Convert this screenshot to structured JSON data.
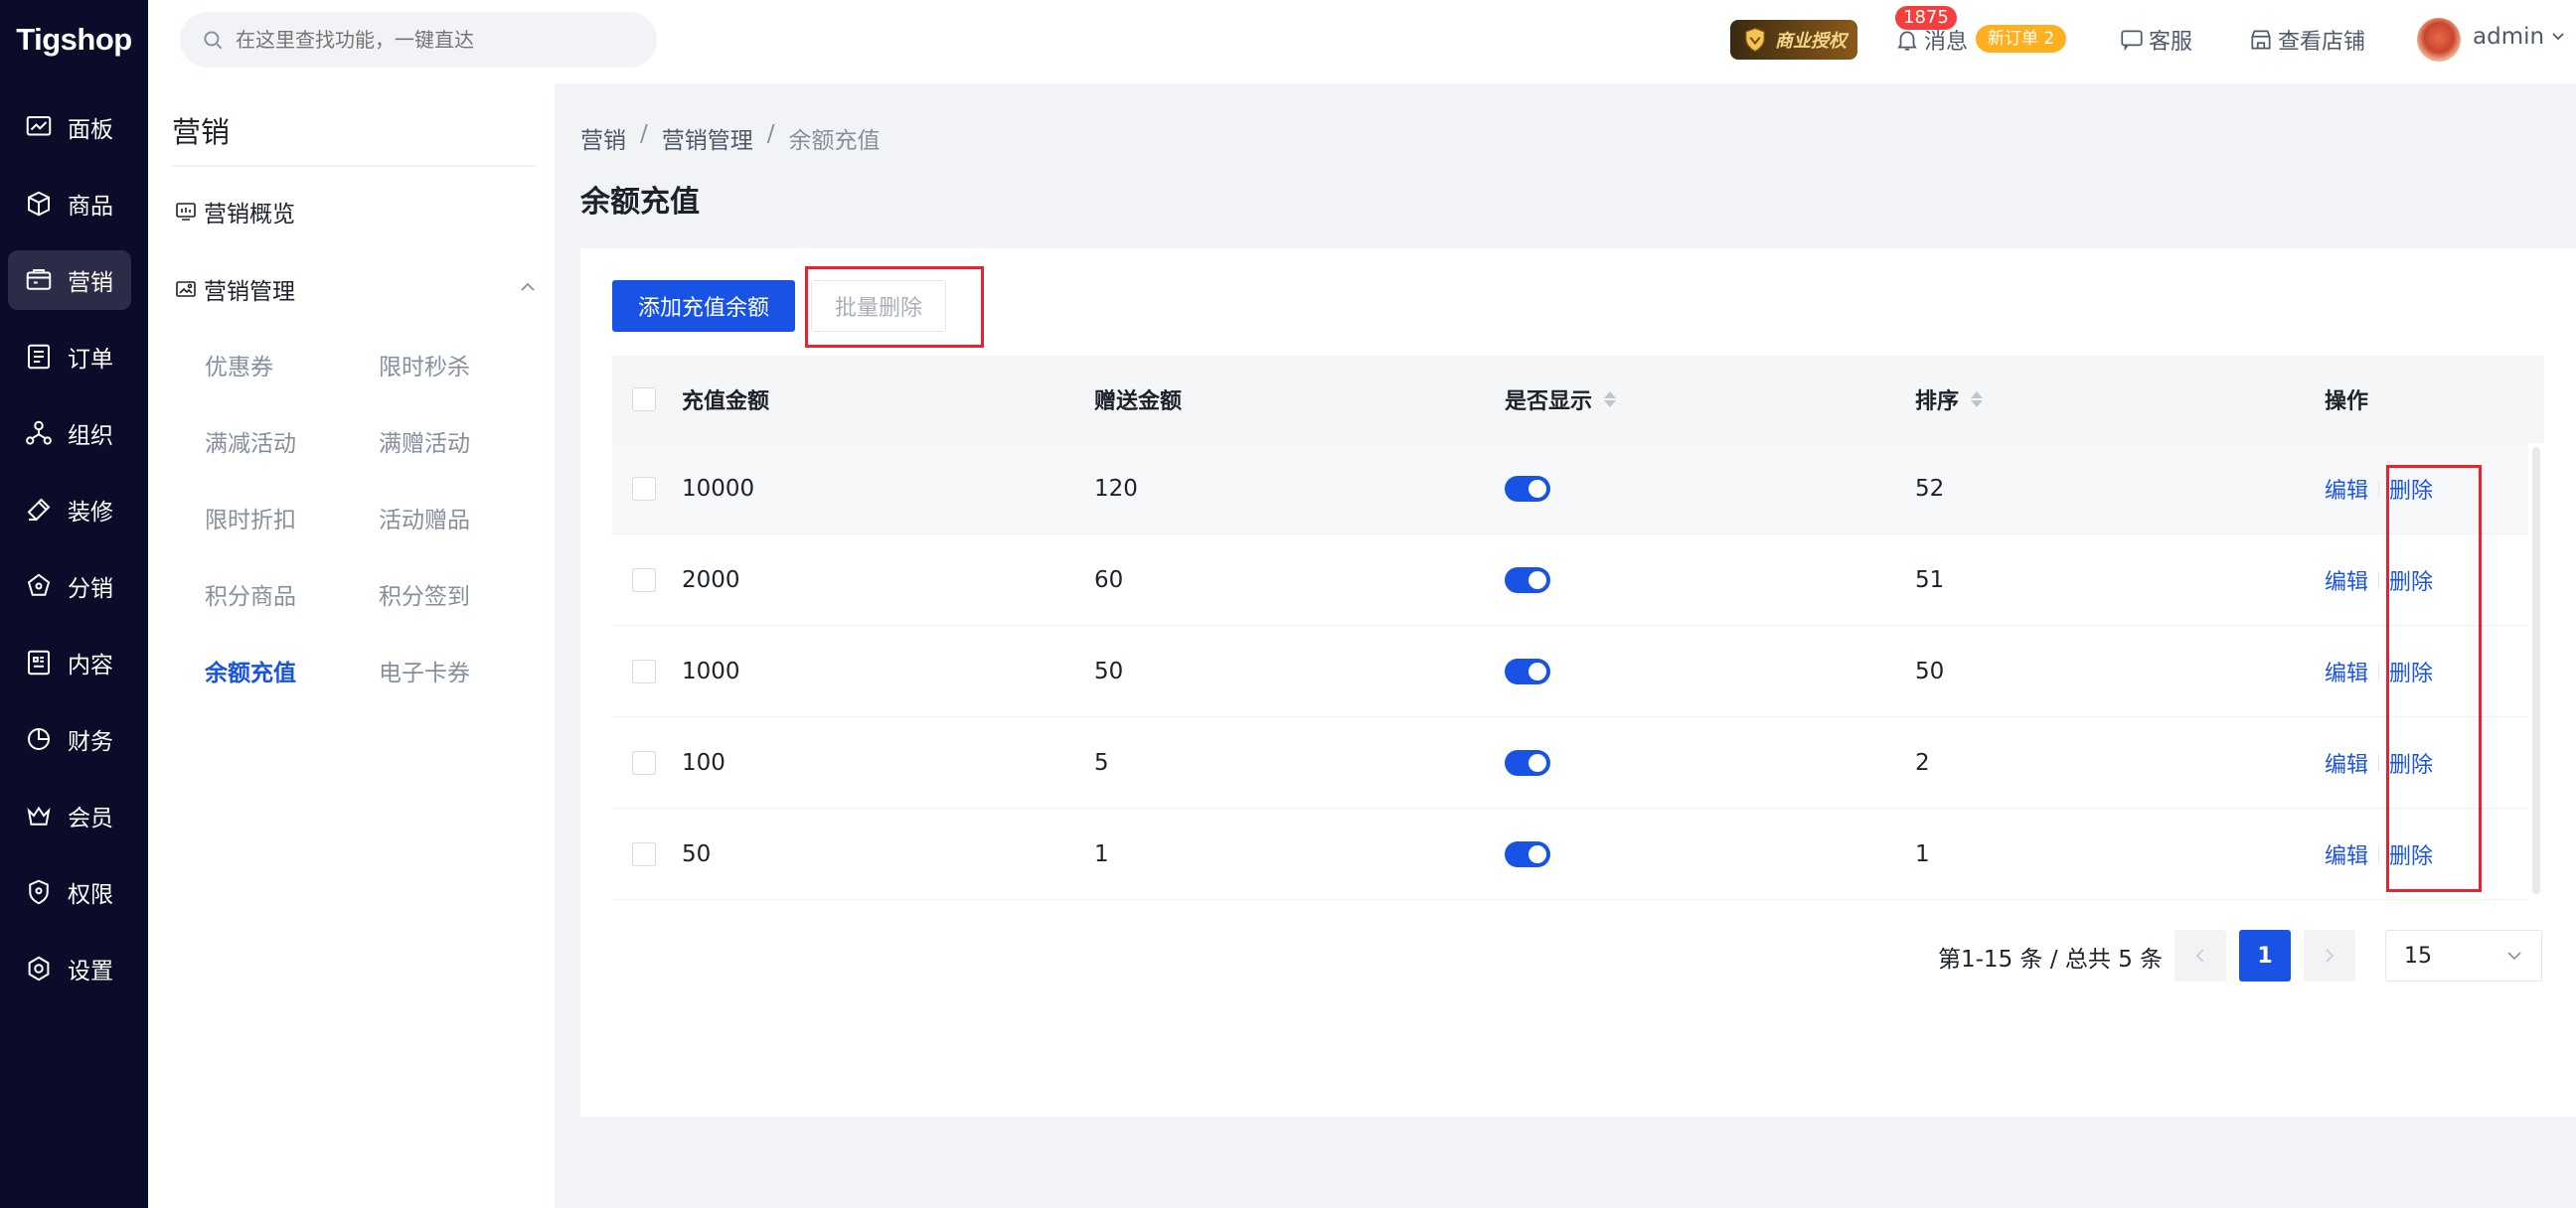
{
  "app": {
    "logo_text": "Tigshop"
  },
  "left_nav": {
    "items": [
      {
        "label": "面板",
        "icon": "dashboard-icon"
      },
      {
        "label": "商品",
        "icon": "box-icon"
      },
      {
        "label": "营销",
        "icon": "marketing-icon",
        "active": true
      },
      {
        "label": "订单",
        "icon": "order-icon"
      },
      {
        "label": "组织",
        "icon": "org-icon"
      },
      {
        "label": "装修",
        "icon": "paint-icon"
      },
      {
        "label": "分销",
        "icon": "distribution-icon"
      },
      {
        "label": "内容",
        "icon": "content-icon"
      },
      {
        "label": "财务",
        "icon": "finance-icon"
      },
      {
        "label": "会员",
        "icon": "crown-icon"
      },
      {
        "label": "权限",
        "icon": "shield-icon"
      },
      {
        "label": "设置",
        "icon": "gear-icon"
      }
    ]
  },
  "header": {
    "search_placeholder": "在这里查找功能，一键直达",
    "auth_badge": "商业授权",
    "message_count": "1875",
    "message_label": "消息",
    "new_order_badge": "新订单 2",
    "service_label": "客服",
    "shop_label": "查看店铺",
    "user_name": "admin"
  },
  "sub_nav": {
    "title": "营销",
    "overview_label": "营销概览",
    "group_label": "营销管理",
    "links": [
      {
        "label": "优惠券"
      },
      {
        "label": "限时秒杀"
      },
      {
        "label": "满减活动"
      },
      {
        "label": "满赠活动"
      },
      {
        "label": "限时折扣"
      },
      {
        "label": "活动赠品"
      },
      {
        "label": "积分商品"
      },
      {
        "label": "积分签到"
      },
      {
        "label": "余额充值",
        "active": true
      },
      {
        "label": "电子卡券"
      }
    ]
  },
  "breadcrumb": [
    "营销",
    "营销管理",
    "余额充值"
  ],
  "page_title": "余额充值",
  "toolbar": {
    "add_label": "添加充值余额",
    "batch_delete_label": "批量删除"
  },
  "table": {
    "headers": {
      "amount": "充值金额",
      "bonus": "赠送金额",
      "show": "是否显示",
      "sort": "排序",
      "action": "操作"
    },
    "rows": [
      {
        "amount": "10000",
        "bonus": "120",
        "show": true,
        "sort": "52"
      },
      {
        "amount": "2000",
        "bonus": "60",
        "show": true,
        "sort": "51"
      },
      {
        "amount": "1000",
        "bonus": "50",
        "show": true,
        "sort": "50"
      },
      {
        "amount": "100",
        "bonus": "5",
        "show": true,
        "sort": "2"
      },
      {
        "amount": "50",
        "bonus": "1",
        "show": true,
        "sort": "1"
      }
    ],
    "edit_label": "编辑",
    "delete_label": "删除"
  },
  "pagination": {
    "summary": "第1-15 条 / 总共 5 条",
    "current_page": "1",
    "page_size": "15"
  },
  "colors": {
    "primary": "#1953e6",
    "sidebar_bg": "#0b0b2a",
    "highlight": "#e8222e",
    "badge_red": "#f53f3f",
    "badge_orange": "#ffb020"
  }
}
